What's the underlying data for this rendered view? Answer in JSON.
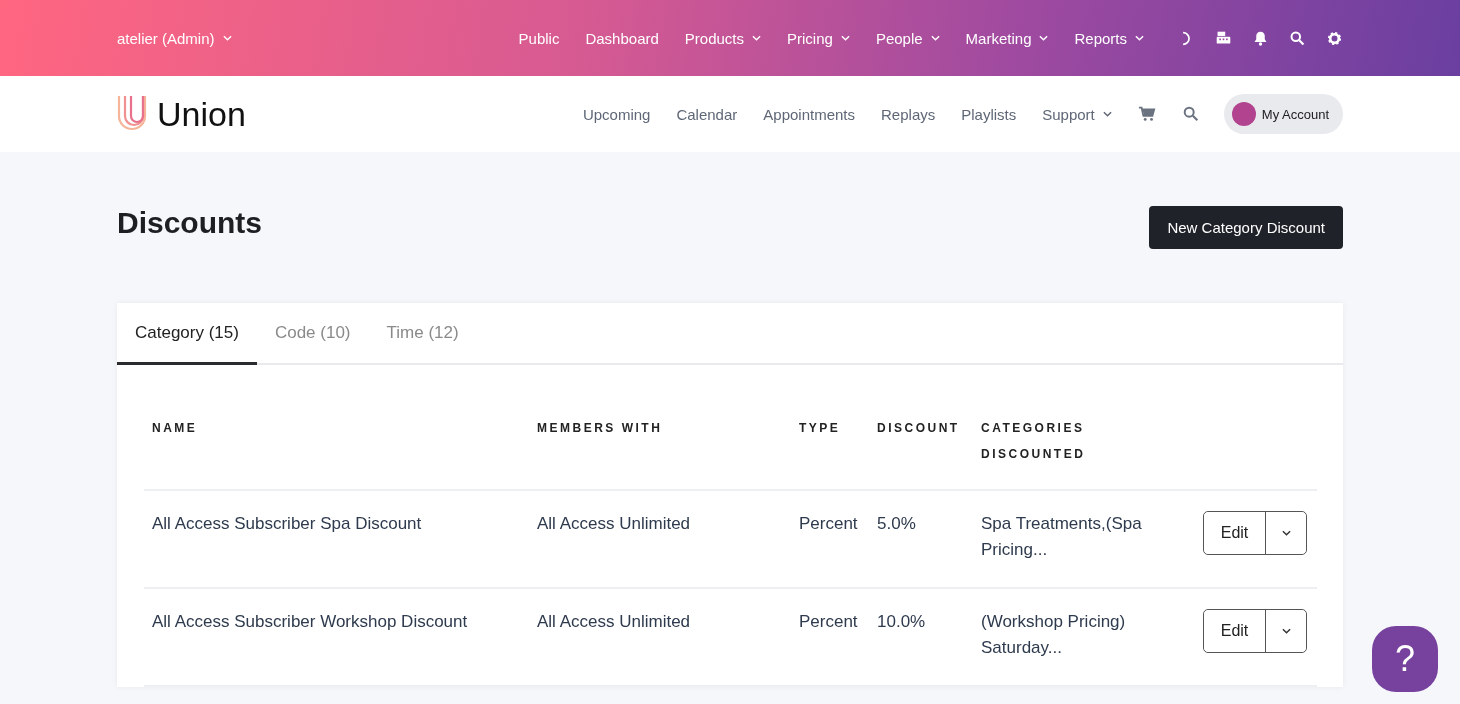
{
  "admin_bar": {
    "account": {
      "label": "atelier (Admin)",
      "dropdown": true
    },
    "links": [
      {
        "label": "Public",
        "dropdown": false
      },
      {
        "label": "Dashboard",
        "dropdown": false
      },
      {
        "label": "Products",
        "dropdown": true
      },
      {
        "label": "Pricing",
        "dropdown": true
      },
      {
        "label": "People",
        "dropdown": true
      },
      {
        "label": "Marketing",
        "dropdown": true
      },
      {
        "label": "Reports",
        "dropdown": true
      }
    ]
  },
  "site_bar": {
    "brand": "Union",
    "links": [
      {
        "label": "Upcoming",
        "dropdown": false
      },
      {
        "label": "Calendar",
        "dropdown": false
      },
      {
        "label": "Appointments",
        "dropdown": false
      },
      {
        "label": "Replays",
        "dropdown": false
      },
      {
        "label": "Playlists",
        "dropdown": false
      },
      {
        "label": "Support",
        "dropdown": true
      }
    ],
    "account_button": "My Account"
  },
  "page": {
    "title": "Discounts",
    "action_button": "New Category Discount"
  },
  "tabs": [
    {
      "label": "Category (15)",
      "selected": true
    },
    {
      "label": "Code (10)",
      "selected": false
    },
    {
      "label": "Time (12)",
      "selected": false
    }
  ],
  "table": {
    "columns": [
      "NAME",
      "MEMBERS WITH",
      "TYPE",
      "DISCOUNT",
      "CATEGORIES DISCOUNTED"
    ],
    "rows": [
      {
        "cells": [
          "All Access Subscriber Spa Discount",
          "All Access Unlimited",
          "Percent",
          "5.0%",
          "Spa Treatments,(Spa Pricing..."
        ],
        "action": "Edit"
      },
      {
        "cells": [
          "All Access Subscriber Workshop Discount",
          "All Access Unlimited",
          "Percent",
          "10.0%",
          "(Workshop Pricing) Saturday..."
        ],
        "action": "Edit"
      }
    ]
  },
  "help_button": "?"
}
